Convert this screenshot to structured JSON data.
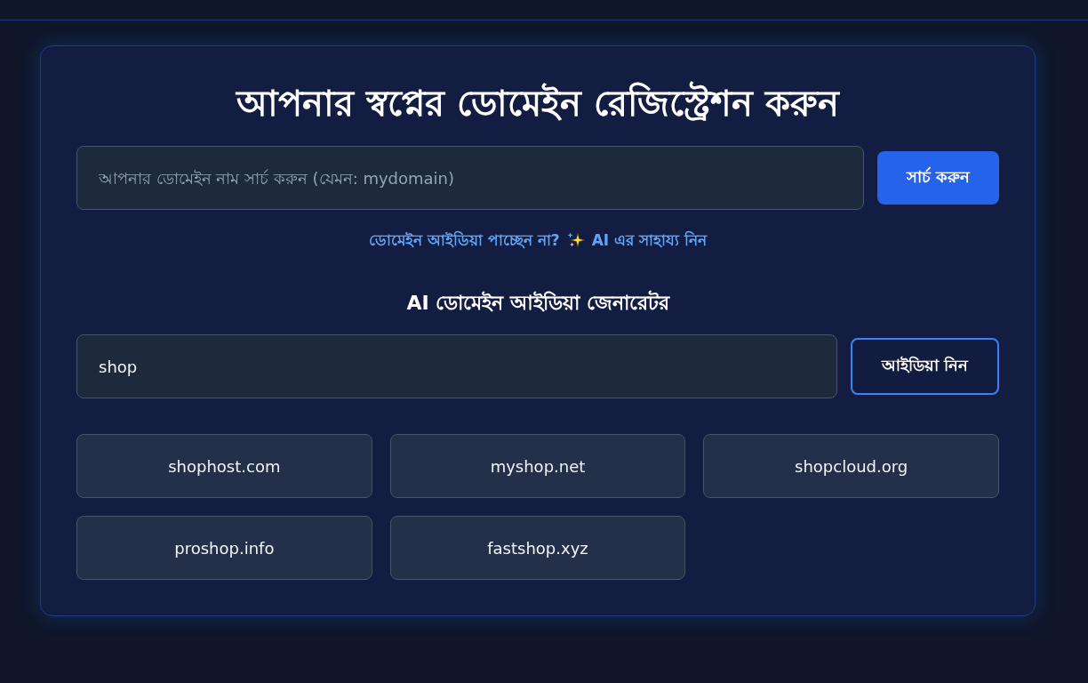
{
  "title": "আপনার স্বপ্নের ডোমেইন রেজিস্ট্রেশন করুন",
  "search": {
    "placeholder": "আপনার ডোমেইন নাম সার্চ করুন (যেমন: mydomain)",
    "button": "সার্চ করুন"
  },
  "ai_link": {
    "text_before": "ডোমেইন আইডিয়া পাচ্ছেন না?",
    "text_after": "AI এর সাহায্য নিন"
  },
  "generator": {
    "heading": "AI ডোমেইন আইডিয়া জেনারেটর",
    "input_value": "shop",
    "button": "আইডিয়া নিন",
    "suggestions": [
      "shophost.com",
      "myshop.net",
      "shopcloud.org",
      "proshop.info",
      "fastshop.xyz"
    ]
  }
}
